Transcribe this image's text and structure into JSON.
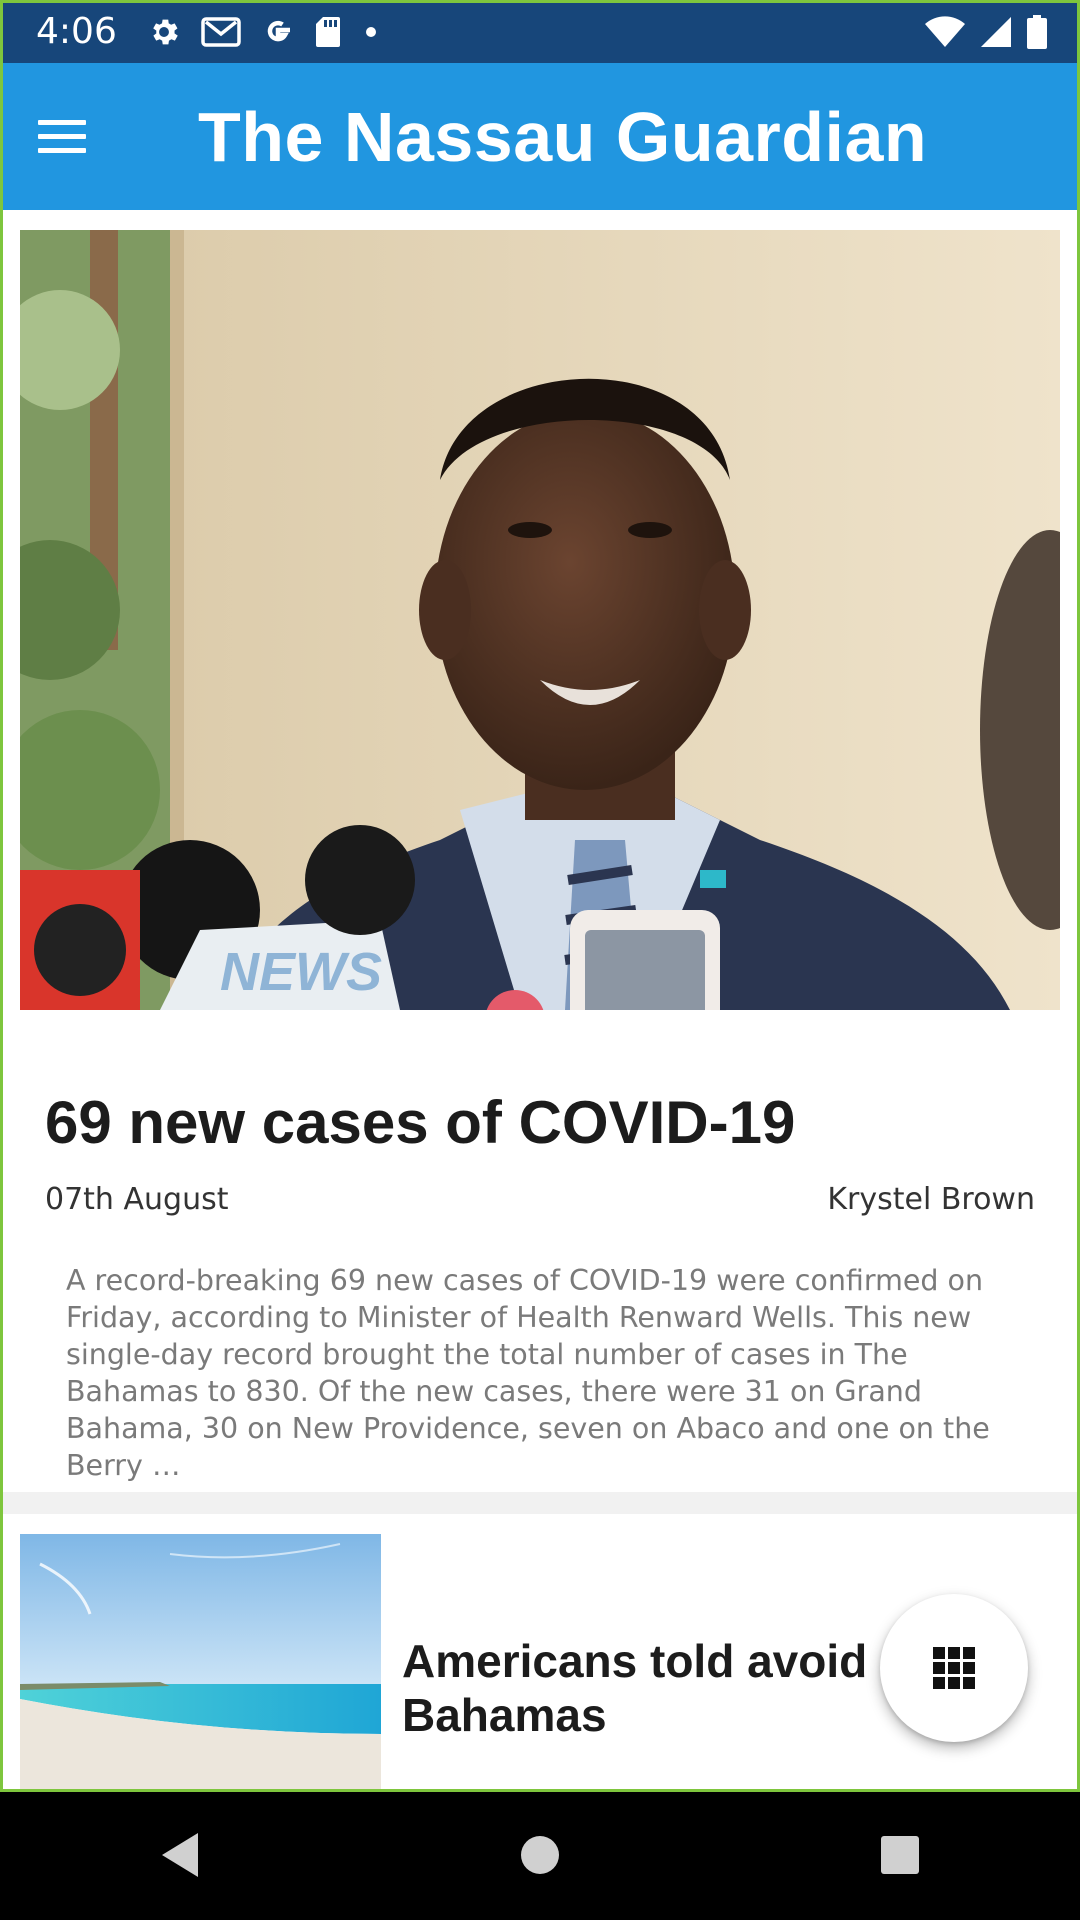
{
  "status_bar": {
    "time": "4:06",
    "icons_left": [
      "settings-gear-icon",
      "gmail-icon",
      "google-icon",
      "sd-card-icon",
      "notification-dot-icon"
    ],
    "icons_right": [
      "wifi-icon",
      "cell-signal-icon",
      "battery-icon"
    ]
  },
  "app_bar": {
    "menu_icon": "hamburger-menu-icon",
    "title": "The Nassau Guardian",
    "color": "#2196e0"
  },
  "articles": [
    {
      "image": "man-in-suit-speaking-to-microphones",
      "headline": "69 new cases of COVID-19",
      "date": "07th August",
      "author": "Krystel Brown",
      "excerpt": "A record-breaking 69 new cases of COVID-19 were confirmed on Friday, according to Minister of Health Renward Wells. This new single-day record brought the total number of cases in The Bahamas to 830. Of the new cases, there were 31 on Grand Bahama, 30 on New Providence, seven on Abaco and one on the Berry …"
    },
    {
      "image": "beach-and-turquoise-sea",
      "headline": "Americans told avoid Bahamas"
    }
  ],
  "fab": {
    "icon": "grid-apps-icon"
  },
  "nav_bar": {
    "buttons": [
      "back-triangle-icon",
      "home-circle-icon",
      "recents-square-icon"
    ]
  },
  "colors": {
    "status_bar": "#17467a",
    "accent": "#2196e0",
    "frame": "#7ec63d"
  }
}
